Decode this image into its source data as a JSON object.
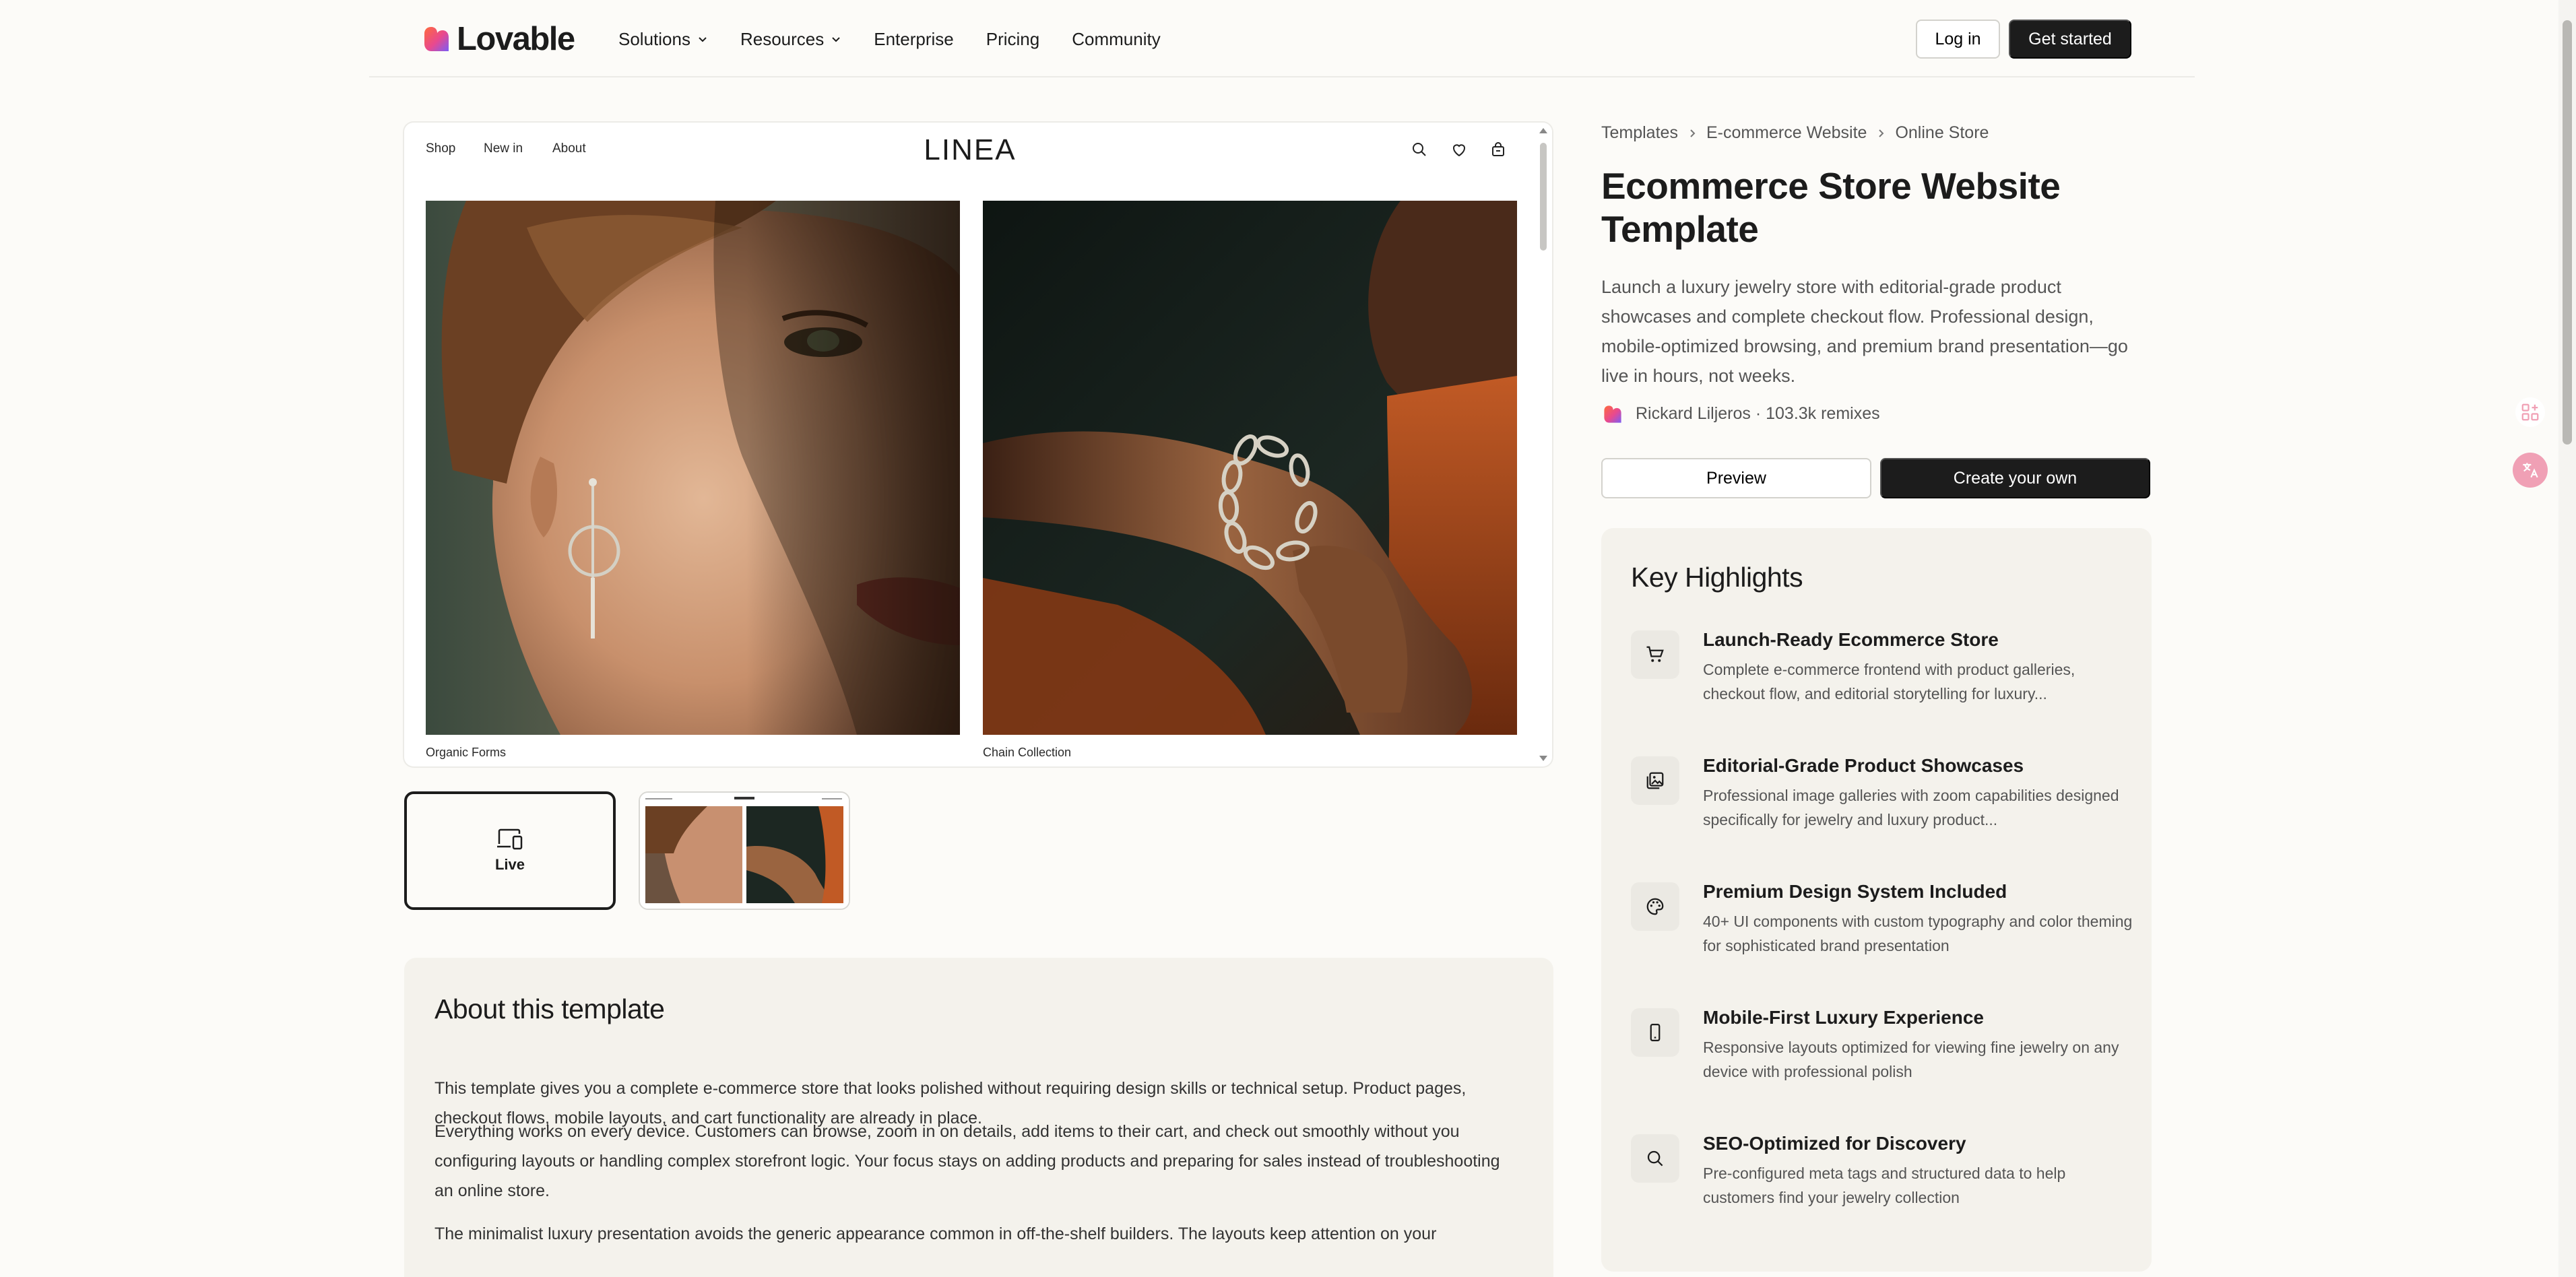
{
  "nav": {
    "logo": "Lovable",
    "links": [
      {
        "label": "Solutions",
        "dropdown": true
      },
      {
        "label": "Resources",
        "dropdown": true
      },
      {
        "label": "Enterprise",
        "dropdown": false
      },
      {
        "label": "Pricing",
        "dropdown": false
      },
      {
        "label": "Community",
        "dropdown": false
      }
    ],
    "login": "Log in",
    "get_started": "Get started"
  },
  "preview": {
    "links": [
      "Shop",
      "New in",
      "About"
    ],
    "brand": "LINEA",
    "icons": [
      "search-icon",
      "heart-icon",
      "bag-icon"
    ],
    "products": [
      "Organic Forms",
      "Chain Collection"
    ]
  },
  "thumbs": {
    "live": "Live"
  },
  "about": {
    "heading": "About this template",
    "paragraphs": [
      "This template gives you a complete e-commerce store that looks polished without requiring design skills or technical setup. Product pages, checkout flows, mobile layouts, and cart functionality are already in place.",
      "Everything works on every device. Customers can browse, zoom in on details, add items to their cart, and check out smoothly without you configuring layouts or handling complex storefront logic. Your focus stays on adding products and preparing for sales instead of troubleshooting an online store.",
      "The minimalist luxury presentation avoids the generic appearance common in off-the-shelf builders. The layouts keep attention on your"
    ]
  },
  "breadcrumb": [
    "Templates",
    "E-commerce Website",
    "Online Store"
  ],
  "template": {
    "title": "Ecommerce Store Website Template",
    "description": "Launch a luxury jewelry store with editorial-grade product showcases and complete checkout flow. Professional design, mobile-optimized browsing, and premium brand presentation—go live in hours, not weeks.",
    "author": "Rickard Liljeros · 103.3k remixes",
    "preview_button": "Preview",
    "create_button": "Create your own"
  },
  "highlights": {
    "heading": "Key Highlights",
    "items": [
      {
        "icon": "cart-icon",
        "title": "Launch-Ready Ecommerce Store",
        "desc": "Complete e-commerce frontend with product galleries, checkout flow, and editorial storytelling for luxury..."
      },
      {
        "icon": "image-icon",
        "title": "Editorial-Grade Product Showcases",
        "desc": "Professional image galleries with zoom capabilities designed specifically for jewelry and luxury product..."
      },
      {
        "icon": "palette-icon",
        "title": "Premium Design System Included",
        "desc": "40+ UI components with custom typography and color theming for sophisticated brand presentation"
      },
      {
        "icon": "smartphone-icon",
        "title": "Mobile-First Luxury Experience",
        "desc": "Responsive layouts optimized for viewing fine jewelry on any device with professional polish"
      },
      {
        "icon": "search-icon",
        "title": "SEO-Optimized for Discovery",
        "desc": "Pre-configured meta tags and structured data to help customers find your jewelry collection"
      }
    ]
  },
  "colors": {
    "background": "#fcfbf8",
    "card": "#f4f2ec",
    "primary_button": "#1c1c1c",
    "logo_gradient": [
      "#ff6a3d",
      "#e8498f",
      "#7b5cf5"
    ]
  }
}
